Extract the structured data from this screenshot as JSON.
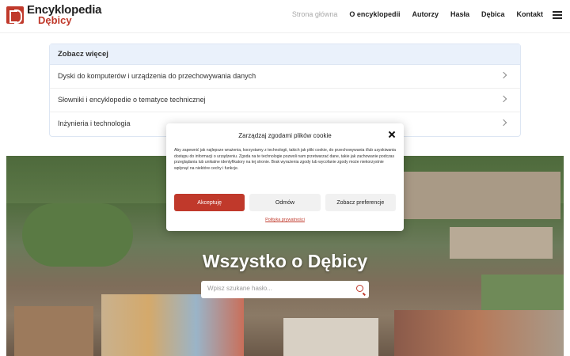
{
  "header": {
    "logo_title": "Encyklopedia",
    "logo_sub": "Dębicy",
    "nav": [
      "Strona główna",
      "O encyklopedii",
      "Autorzy",
      "Hasła",
      "Dębica",
      "Kontakt"
    ]
  },
  "see_more": {
    "title": "Zobacz więcej",
    "items": [
      "Dyski do komputerów i urządzenia do przechowywania danych",
      "Słowniki i encyklopedie o tematyce technicznej",
      "Inżynieria i technologia"
    ]
  },
  "hero": {
    "title": "Wszystko o Dębicy",
    "search_placeholder": "Wpisz szukane hasło..."
  },
  "cookie": {
    "title": "Zarządzaj zgodami plików cookie",
    "text": "Aby zapewnić jak najlepsze wrażenia, korzystamy z technologii, takich jak pliki cookie, do przechowywania i/lub uzyskiwania dostępu do informacji o urządzeniu. Zgoda na te technologie pozwoli nam przetwarzać dane, takie jak zachowanie podczas przeglądania lub unikalne identyfikatory na tej stronie. Brak wyrażenia zgody lub wycofanie zgody może niekorzystnie wpłynąć na niektóre cechy i funkcje.",
    "accept": "Akceptuję",
    "deny": "Odmów",
    "preferences": "Zobacz preferencje",
    "privacy_link": "Polityka prywatności"
  },
  "colors": {
    "accent": "#c0392b"
  }
}
